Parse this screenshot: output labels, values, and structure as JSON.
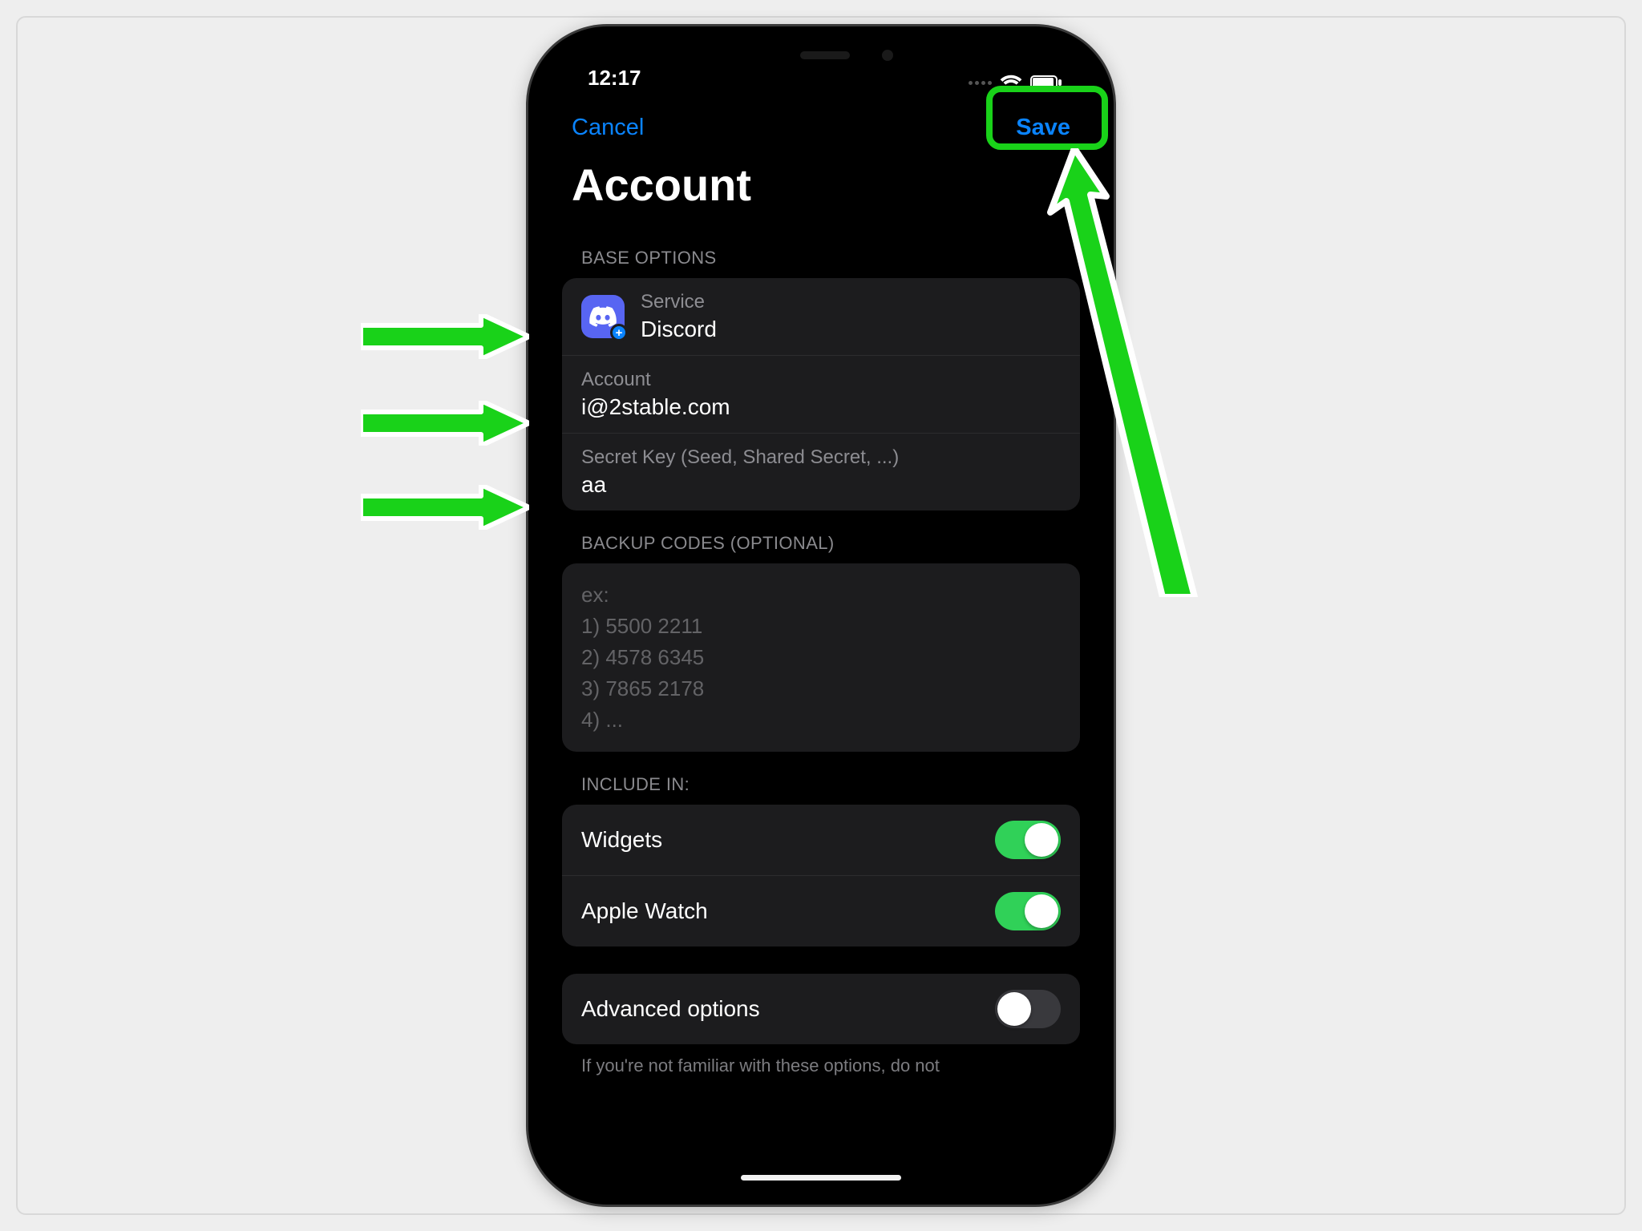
{
  "status": {
    "time": "12:17"
  },
  "nav": {
    "cancel": "Cancel",
    "save": "Save"
  },
  "title": "Account",
  "sections": {
    "base_header": "BASE OPTIONS",
    "service_label": "Service",
    "service_value": "Discord",
    "account_label": "Account",
    "account_value": "i@2stable.com",
    "secret_label": "Secret Key (Seed, Shared Secret, ...)",
    "secret_value": "aa",
    "backup_header": "BACKUP CODES (OPTIONAL)",
    "backup_placeholder": "ex:\n1) 5500 2211\n2) 4578 6345\n3) 7865 2178\n4) ...",
    "include_header": "INCLUDE IN:",
    "widgets_label": "Widgets",
    "applewatch_label": "Apple Watch",
    "advanced_label": "Advanced options",
    "advanced_hint": "If you're not familiar with these options, do not"
  },
  "toggles": {
    "widgets": true,
    "applewatch": true,
    "advanced": false
  },
  "colors": {
    "accent": "#0a84ff",
    "discord": "#5865f2",
    "switch_on": "#30d158",
    "annotation": "#19d219"
  }
}
